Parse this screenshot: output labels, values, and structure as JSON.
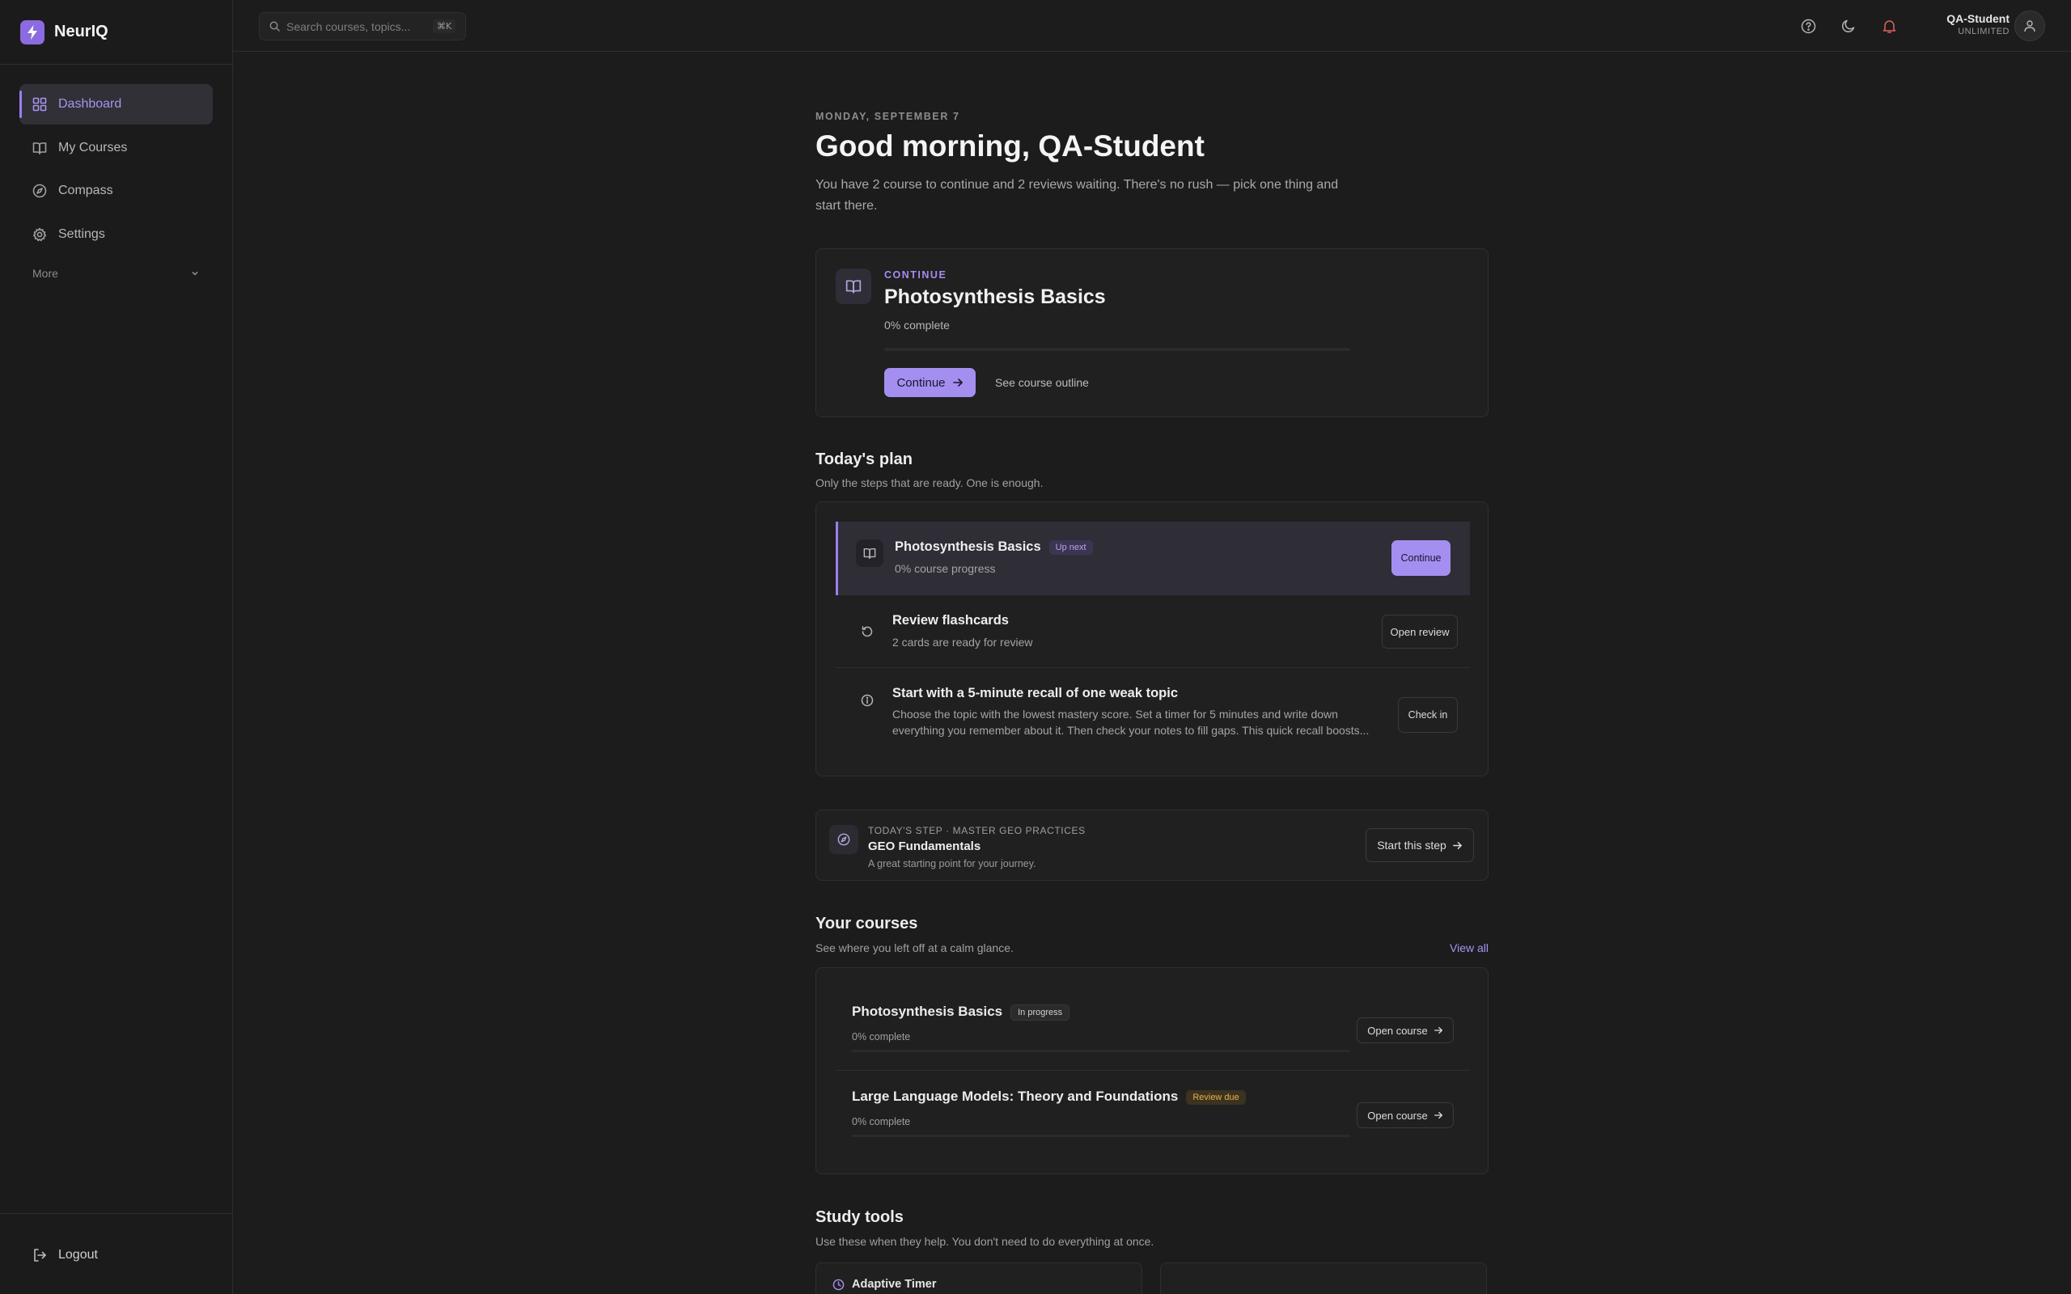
{
  "app": {
    "name": "NeurIQ"
  },
  "sidebar": {
    "items": [
      {
        "label": "Dashboard",
        "icon": "grid-icon",
        "active": true
      },
      {
        "label": "My Courses",
        "icon": "book-icon"
      },
      {
        "label": "Compass",
        "icon": "compass-icon"
      },
      {
        "label": "Settings",
        "icon": "gear-icon"
      }
    ],
    "more_label": "More",
    "logout_label": "Logout"
  },
  "topbar": {
    "search_placeholder": "Search courses, topics...",
    "search_shortcut": "⌘K",
    "user_name": "QA-Student",
    "user_plan": "UNLIMITED"
  },
  "header": {
    "date": "MONDAY, SEPTEMBER 7",
    "greeting": "Good morning, QA-Student",
    "intro": "You have 2 course to continue and 2 reviews waiting. There's no rush — pick one thing and start there."
  },
  "continue_card": {
    "label": "CONTINUE",
    "title": "Photosynthesis Basics",
    "progress_text": "0% complete",
    "progress": 0,
    "button_label": "Continue",
    "link_label": "See course outline"
  },
  "plan": {
    "title": "Today's plan",
    "subtitle": "Only the steps that are ready. One is enough.",
    "items": [
      {
        "title": "Photosynthesis Basics",
        "badge": "Up next",
        "subtitle": "0% course progress",
        "button": "Continue"
      },
      {
        "title": "Review flashcards",
        "subtitle": "2 cards are ready for review",
        "button": "Open review"
      },
      {
        "title": "Start with a 5-minute recall of one weak topic",
        "subtitle": "Choose the topic with the lowest mastery score. Set a timer for 5 minutes and write down everything you remember about it. Then check your notes to fill gaps. This quick recall boosts...",
        "button": "Check in"
      }
    ]
  },
  "today_step": {
    "label": "TODAY'S STEP · MASTER GEO PRACTICES",
    "title": "GEO Fundamentals",
    "subtitle": "A great starting point for your journey.",
    "button": "Start this step"
  },
  "courses": {
    "title": "Your courses",
    "subtitle": "See where you left off at a calm glance.",
    "view_all": "View all",
    "items": [
      {
        "title": "Photosynthesis Basics",
        "badge": "In progress",
        "badge_style": "gray",
        "progress_text": "0% complete",
        "progress": 0,
        "button": "Open course"
      },
      {
        "title": "Large Language Models: Theory and Foundations",
        "badge": "Review due",
        "badge_style": "amber",
        "progress_text": "0% complete",
        "progress": 0,
        "button": "Open course"
      }
    ]
  },
  "study_tools": {
    "title": "Study tools",
    "subtitle": "Use these when they help. You don't need to do everything at once.",
    "items": [
      {
        "title": "Adaptive Timer",
        "icon": "clock-icon"
      },
      {
        "title": "",
        "icon": ""
      }
    ]
  },
  "colors": {
    "accent": "#9a7ff0",
    "accent_button": "#a48ff0",
    "background": "#1c1c1c",
    "card": "#202020",
    "review_badge": "#e8b14a"
  }
}
